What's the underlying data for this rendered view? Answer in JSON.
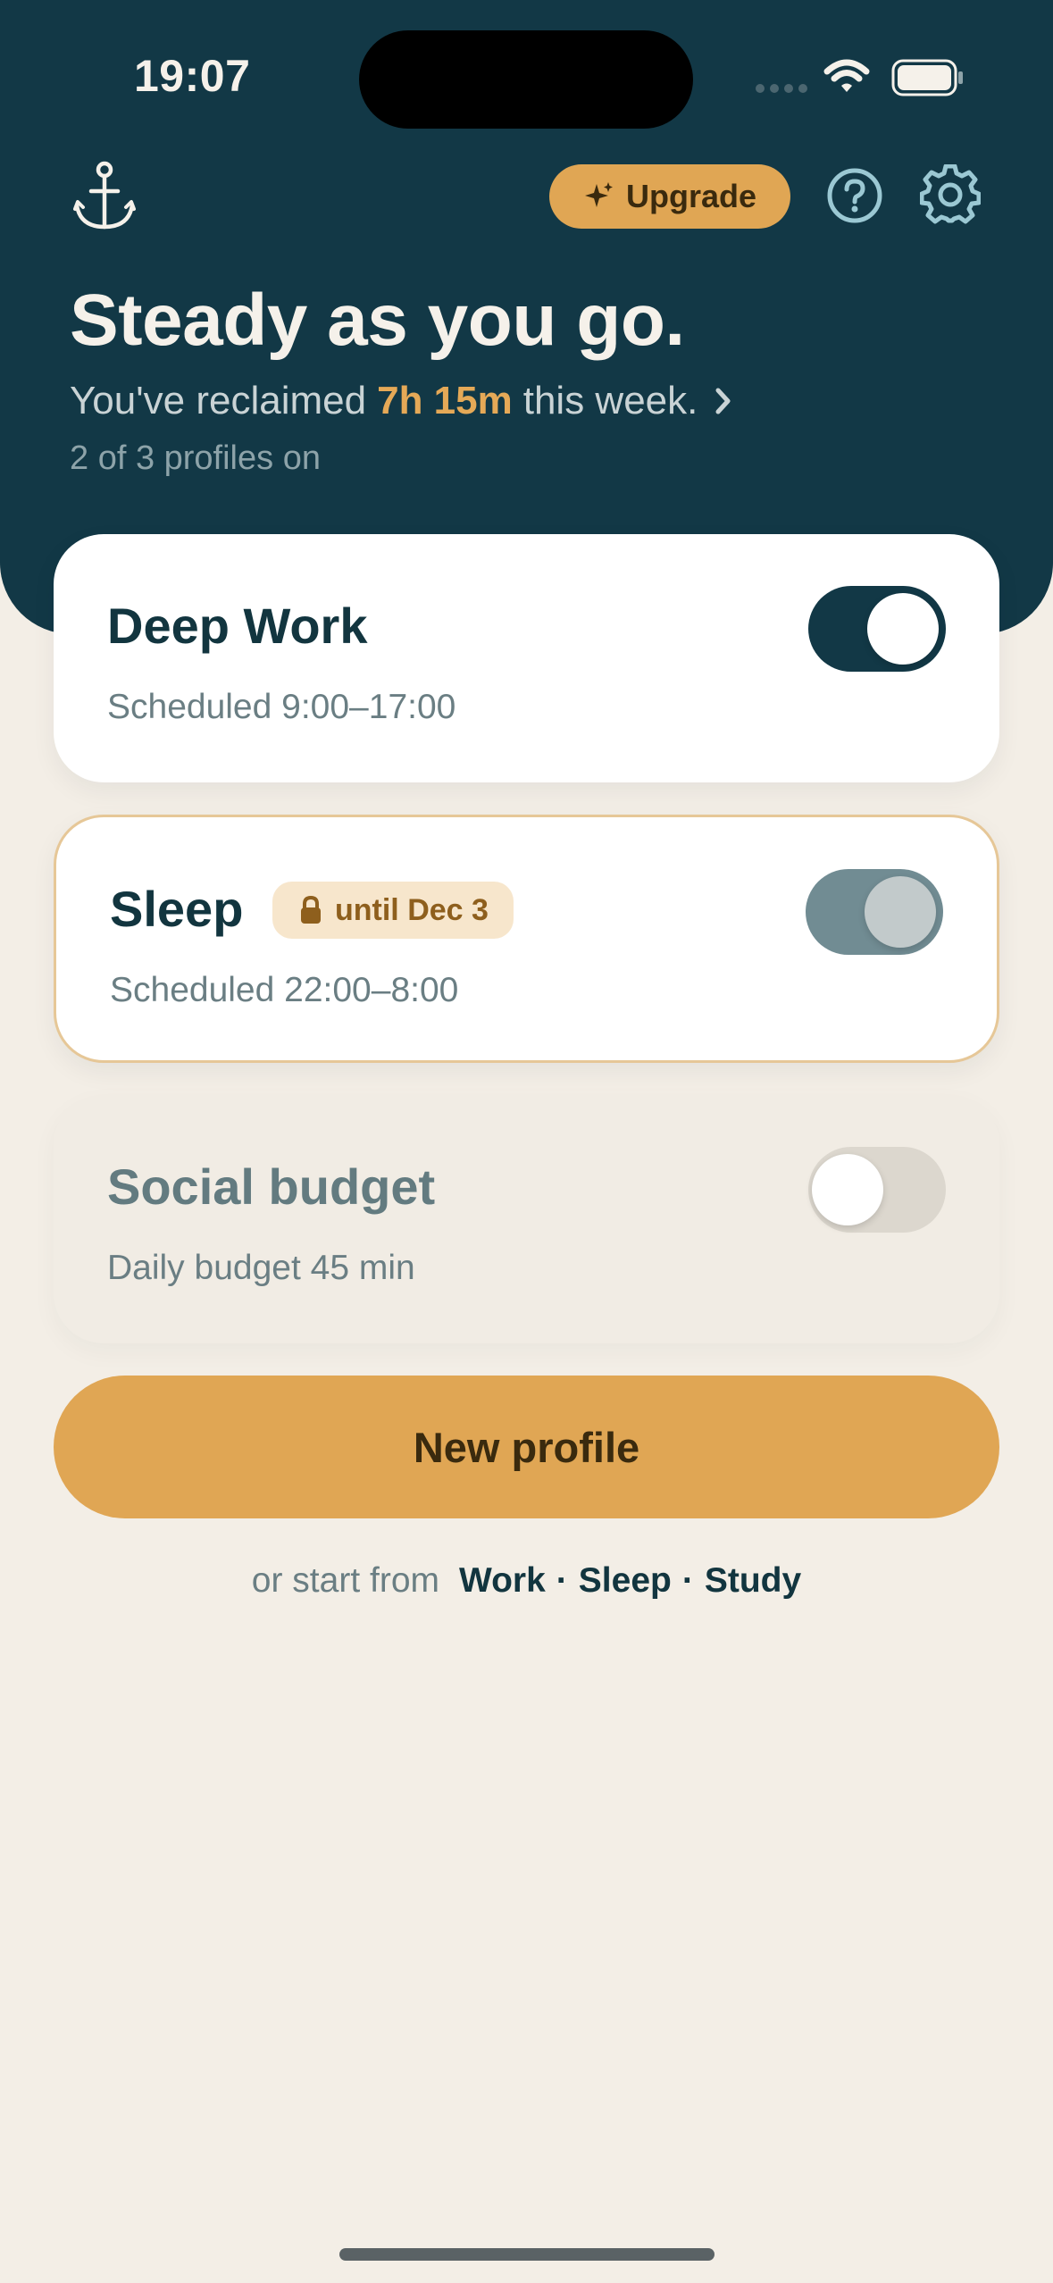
{
  "status_bar": {
    "time": "19:07"
  },
  "header": {
    "upgrade_label": "Upgrade",
    "headline": "Steady as you go.",
    "reclaimed_prefix": "You've reclaimed",
    "reclaimed_amount": "7h 15m",
    "reclaimed_suffix": "this week.",
    "profiles_on": "2 of 3 profiles on"
  },
  "profiles": [
    {
      "name": "Deep Work",
      "subtitle": "Scheduled 9:00–17:00",
      "enabled": true,
      "locked": false
    },
    {
      "name": "Sleep",
      "subtitle": "Scheduled 22:00–8:00",
      "enabled": true,
      "locked": true,
      "lock_label": "until Dec 3"
    },
    {
      "name": "Social budget",
      "subtitle": "Daily budget 45 min",
      "enabled": false,
      "locked": false
    }
  ],
  "new_profile_label": "New profile",
  "templates": {
    "lead": "or start from",
    "items": [
      "Work",
      "Sleep",
      "Study"
    ],
    "separator": "·"
  },
  "colors": {
    "header_bg": "#123846",
    "background": "#F3EEE6",
    "accent": "#E0A654",
    "highlight_text": "#E5A957",
    "lock_border": "#E6C797"
  },
  "icons": {
    "logo": "anchor-icon",
    "upgrade": "sparkle-icon",
    "help": "help-circle-icon",
    "settings": "gear-icon",
    "chevron": "chevron-right-icon",
    "lock": "lock-icon"
  }
}
